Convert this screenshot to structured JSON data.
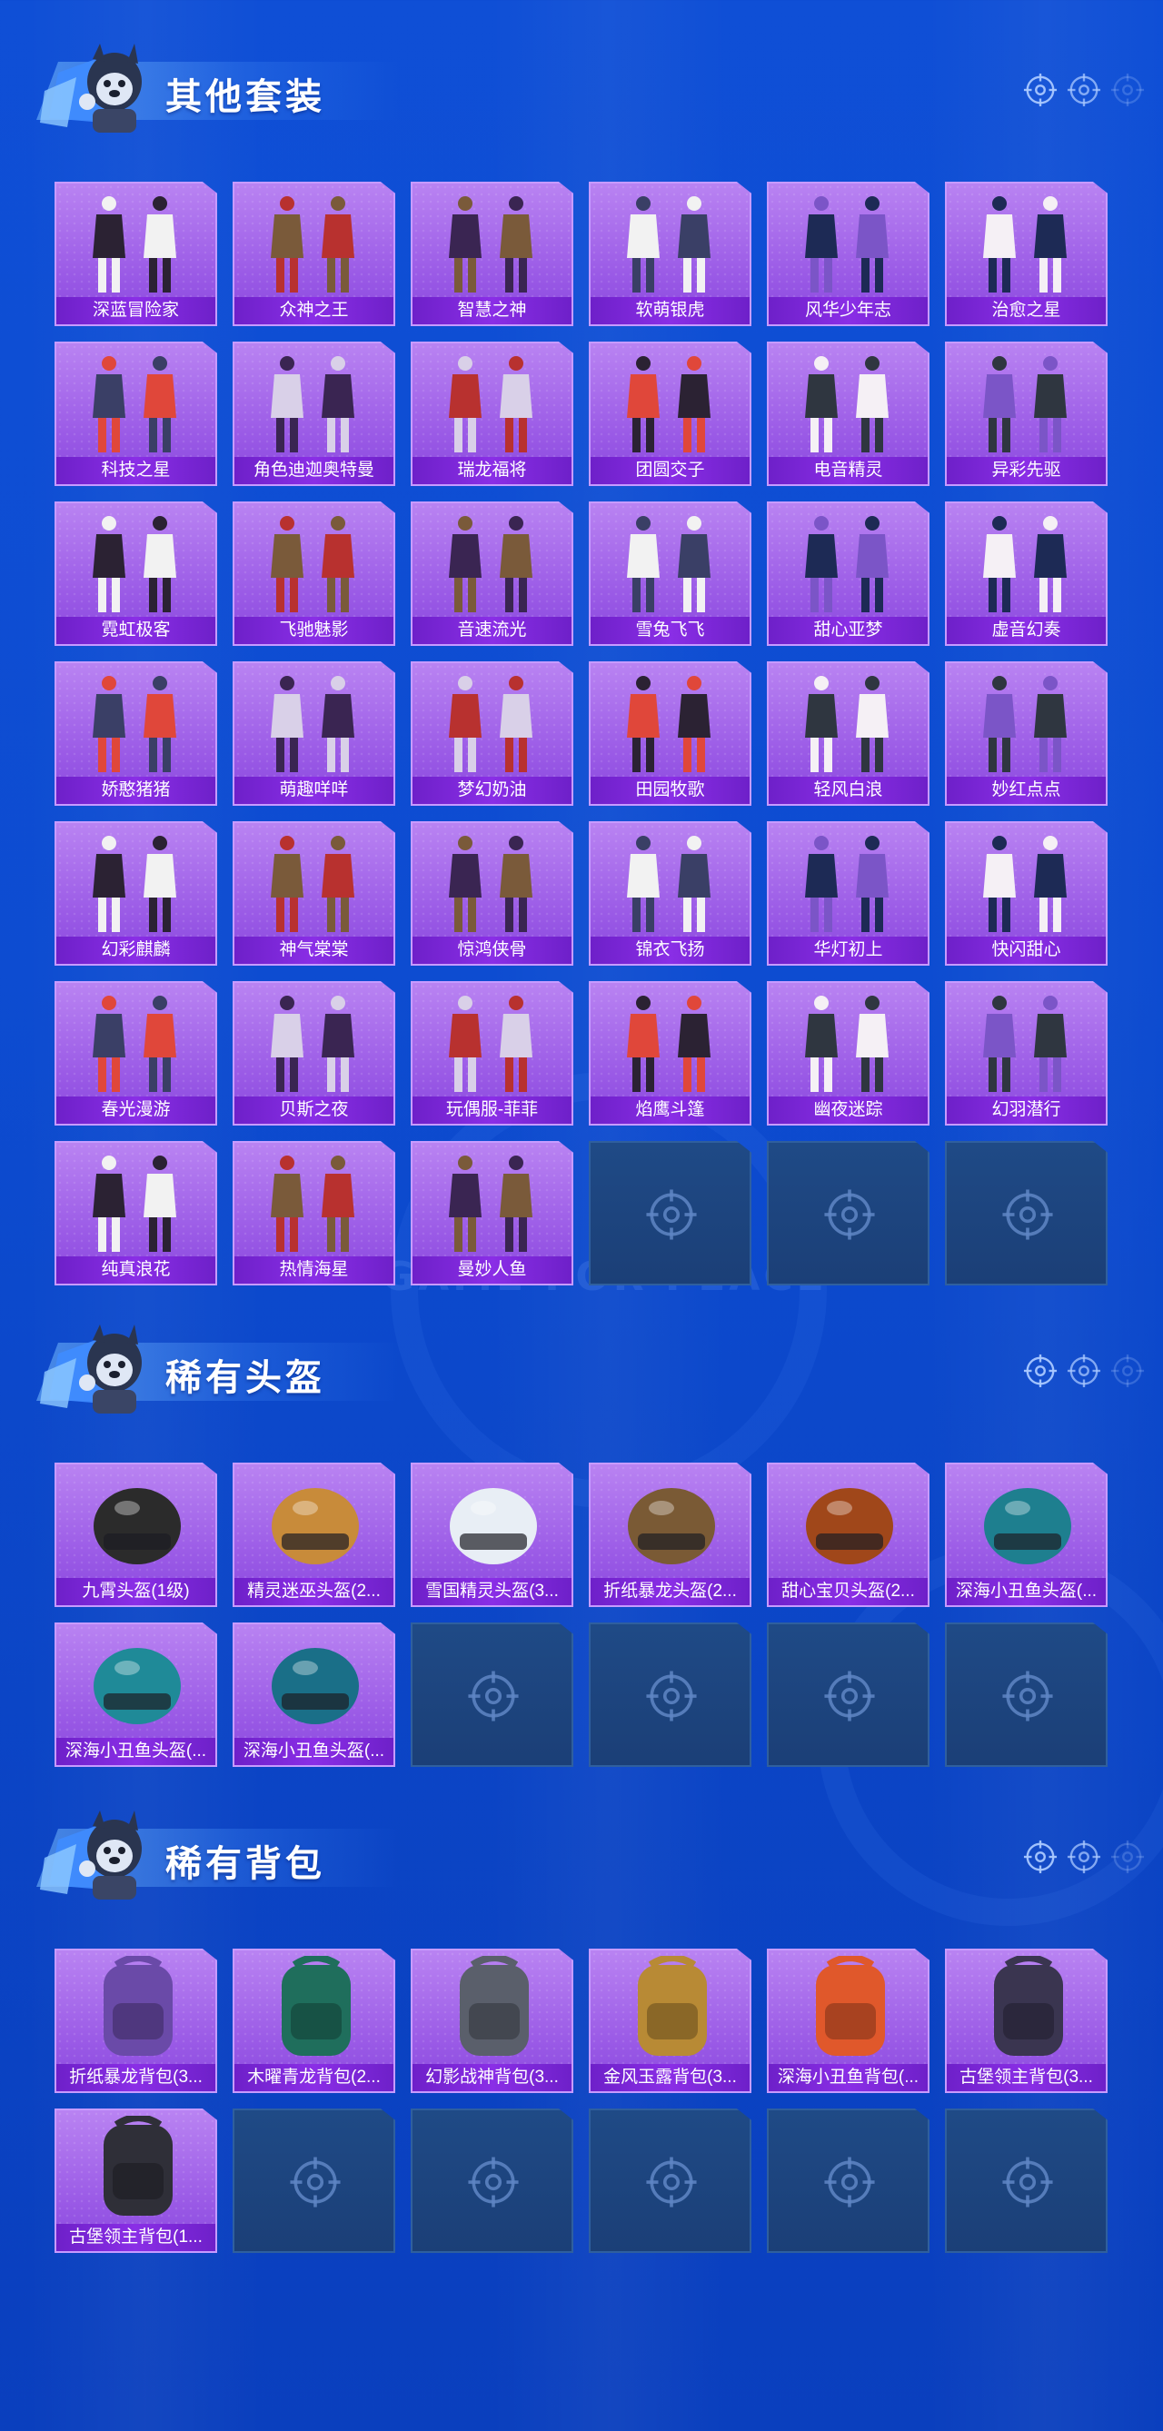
{
  "sections": [
    {
      "title": "其他套装",
      "items": [
        "深蓝冒险家",
        "众神之王",
        "智慧之神",
        "软萌银虎",
        "风华少年志",
        "治愈之星",
        "科技之星",
        "角色迪迦奥特曼",
        "瑞龙福将",
        "团圆交子",
        "电音精灵",
        "异彩先驱",
        "霓虹极客",
        "飞驰魅影",
        "音速流光",
        "雪兔飞飞",
        "甜心亚梦",
        "虚音幻奏",
        "娇憨猪猪",
        "萌趣咩咩",
        "梦幻奶油",
        "田园牧歌",
        "轻风白浪",
        "妙红点点",
        "幻彩麒麟",
        "神气棠棠",
        "惊鸿侠骨",
        "锦衣飞扬",
        "华灯初上",
        "快闪甜心",
        "春光漫游",
        "贝斯之夜",
        "玩偶服-菲菲",
        "焰鹰斗篷",
        "幽夜迷踪",
        "幻羽潜行",
        "纯真浪花",
        "热情海星",
        "曼妙人鱼"
      ],
      "empty_slots": 3
    },
    {
      "title": "稀有头盔",
      "items": [
        "九霄头盔(1级)",
        "精灵迷巫头盔(2...",
        "雪国精灵头盔(3...",
        "折纸暴龙头盔(2...",
        "甜心宝贝头盔(2...",
        "深海小丑鱼头盔(...",
        "深海小丑鱼头盔(...",
        "深海小丑鱼头盔(..."
      ],
      "empty_slots": 4
    },
    {
      "title": "稀有背包",
      "items": [
        "折纸暴龙背包(3...",
        "木曜青龙背包(2...",
        "幻影战神背包(3...",
        "金风玉露背包(3...",
        "深海小丑鱼背包(...",
        "古堡领主背包(3...",
        "古堡领主背包(1..."
      ],
      "empty_slots": 5
    }
  ],
  "watermark": "GAME FOR PEACE",
  "icons": {
    "section_mascot": "mascot-icon",
    "header_reticle": "reticle-icon",
    "empty_slot": "reticle-icon"
  },
  "colors": {
    "background": "#0d4cd1",
    "card": "#9a5ae6",
    "card_label": "#7a26d6",
    "empty_card": "#1d4580"
  }
}
